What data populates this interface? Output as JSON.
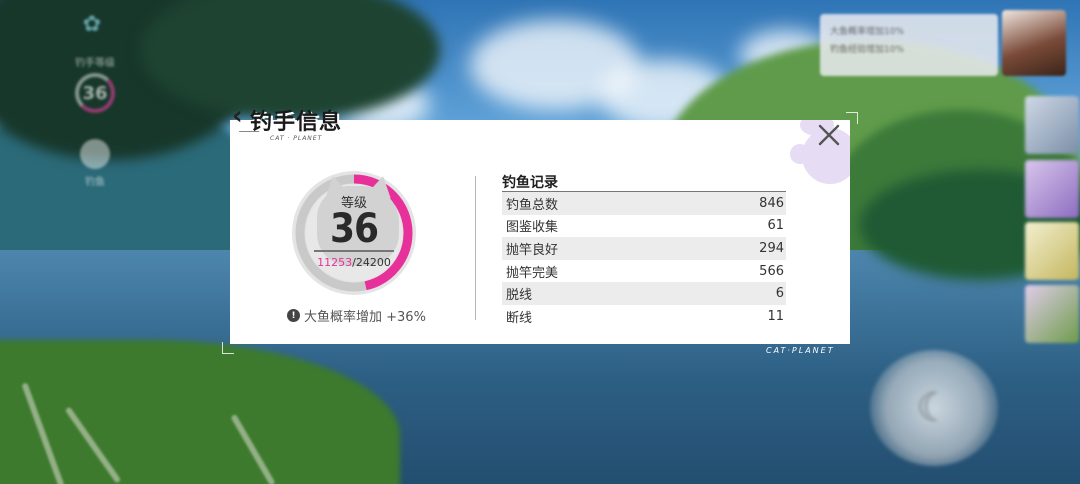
{
  "hud": {
    "level_label": "钓手等级",
    "level_value": "36",
    "fishing_label": "钓鱼",
    "messages": [
      "大鱼概率增加10%",
      "钓鱼经验增加10%"
    ]
  },
  "panel": {
    "title": "钓手信息",
    "subtitle": "CAT · PLANET",
    "brand_tag": "CAT·PLANET",
    "level": {
      "label": "等级",
      "value": "36",
      "exp_current": "11253",
      "exp_separator": "/",
      "exp_max": "24200",
      "progress": 0.465
    },
    "bonus_text": "大鱼概率增加 +36%",
    "records": {
      "title": "钓鱼记录",
      "rows": [
        {
          "label": "钓鱼总数",
          "value": "846"
        },
        {
          "label": "图鉴收集",
          "value": "61"
        },
        {
          "label": "抛竿良好",
          "value": "294"
        },
        {
          "label": "抛竿完美",
          "value": "566"
        },
        {
          "label": "脱线",
          "value": "6"
        },
        {
          "label": "断线",
          "value": "11"
        }
      ]
    }
  },
  "colors": {
    "accent": "#e8309b",
    "ring_track": "#c9c9c9",
    "panel_bg": "#ffffff"
  }
}
